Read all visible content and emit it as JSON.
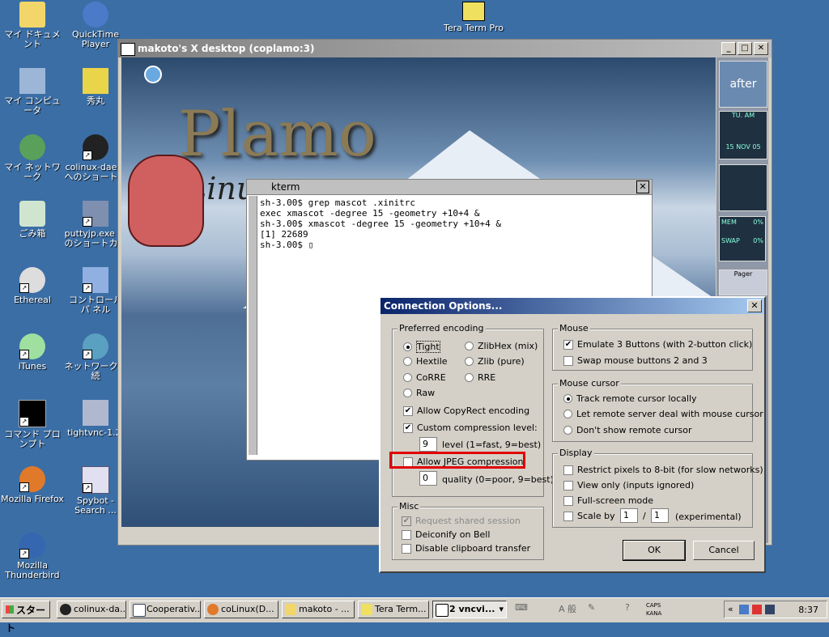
{
  "desktop": {
    "left_icons": [
      "マイ ドキュメント",
      "マイ コンピュータ",
      "マイ ネットワーク",
      "ごみ箱",
      "Ethereal",
      "iTunes",
      "コマンド プロンプト",
      "Mozilla Firefox",
      "Mozilla Thunderbird"
    ],
    "right_icons": [
      "QuickTime Player",
      "秀丸",
      "colinux-dae… へのショートカ",
      "puttyjp.exe へ のショートカッ",
      "コントロール パ ネル",
      "ネットワーク接 続",
      "tightvnc-1.2.",
      "Spybot - Search ..."
    ],
    "top_icon": "Tera Term Pro"
  },
  "vnc_window": {
    "title": "makoto's X desktop (coplamo:3)",
    "status_label": "kterm",
    "minimize": "_",
    "maximize": "□",
    "close": "✕"
  },
  "wallpaper": {
    "logo": "Plamo",
    "logo_sub": "Linux"
  },
  "dock": {
    "clock_top": "TU.  AM",
    "clock_date": "15 NOV 05",
    "mem_label": "MEM",
    "mem_val": "0%",
    "swap_label": "SWAP",
    "swap_val": "0%",
    "pager": "Pager",
    "afterstep": "after"
  },
  "kterm": {
    "title": "kterm",
    "lines": [
      "sh-3.00$ grep mascot .xinitrc",
      "exec xmascot -degree 15 -geometry +10+4 &",
      "sh-3.00$ xmascot -degree 15 -geometry +10+4 &",
      "[1] 22689",
      "sh-3.00$ ▯"
    ]
  },
  "dialog": {
    "title": "Connection Options...",
    "close": "✕",
    "encoding": {
      "label": "Preferred encoding",
      "options": [
        "Tight",
        "ZlibHex (mix)",
        "Hextile",
        "Zlib (pure)",
        "CoRRE",
        "RRE",
        "Raw"
      ],
      "selected": "Tight",
      "copyrect": "Allow CopyRect encoding",
      "custom_comp": "Custom compression level:",
      "level_value": "9",
      "level_label": "level (1=fast, 9=best)",
      "jpeg": "Allow JPEG compression:",
      "quality_value": "0",
      "quality_label": "quality (0=poor, 9=best)"
    },
    "misc": {
      "label": "Misc",
      "items": [
        "Request shared session",
        "Deiconify on Bell",
        "Disable clipboard transfer"
      ]
    },
    "mouse": {
      "label": "Mouse",
      "items": [
        "Emulate 3 Buttons (with 2-button click)",
        "Swap mouse buttons 2 and 3"
      ]
    },
    "cursor": {
      "label": "Mouse cursor",
      "items": [
        "Track remote cursor locally",
        "Let remote server deal with mouse cursor",
        "Don't show remote cursor"
      ]
    },
    "display": {
      "label": "Display",
      "items": [
        "Restrict pixels to 8-bit (for slow networks)",
        "View only (inputs ignored)",
        "Full-screen mode"
      ],
      "scale_label": "Scale by",
      "scale_num": "1",
      "scale_sep": "/",
      "scale_den": "1",
      "scale_note": "(experimental)"
    },
    "ok": "OK",
    "cancel": "Cancel"
  },
  "taskbar": {
    "start": "スタート",
    "tasks": [
      "colinux-da...",
      "Cooperativ...",
      "coLinux(D...",
      "makoto - ...",
      "Tera Term...",
      "2 vncvi..."
    ],
    "ime": "A 般",
    "caps": "CAPS",
    "kana": "KANA",
    "tray_arrow": "«",
    "clock": "8:37"
  },
  "colors": {
    "desktop": "#3a6ea5",
    "dialog_title": "#0a246a",
    "highlight": "#e00000"
  }
}
